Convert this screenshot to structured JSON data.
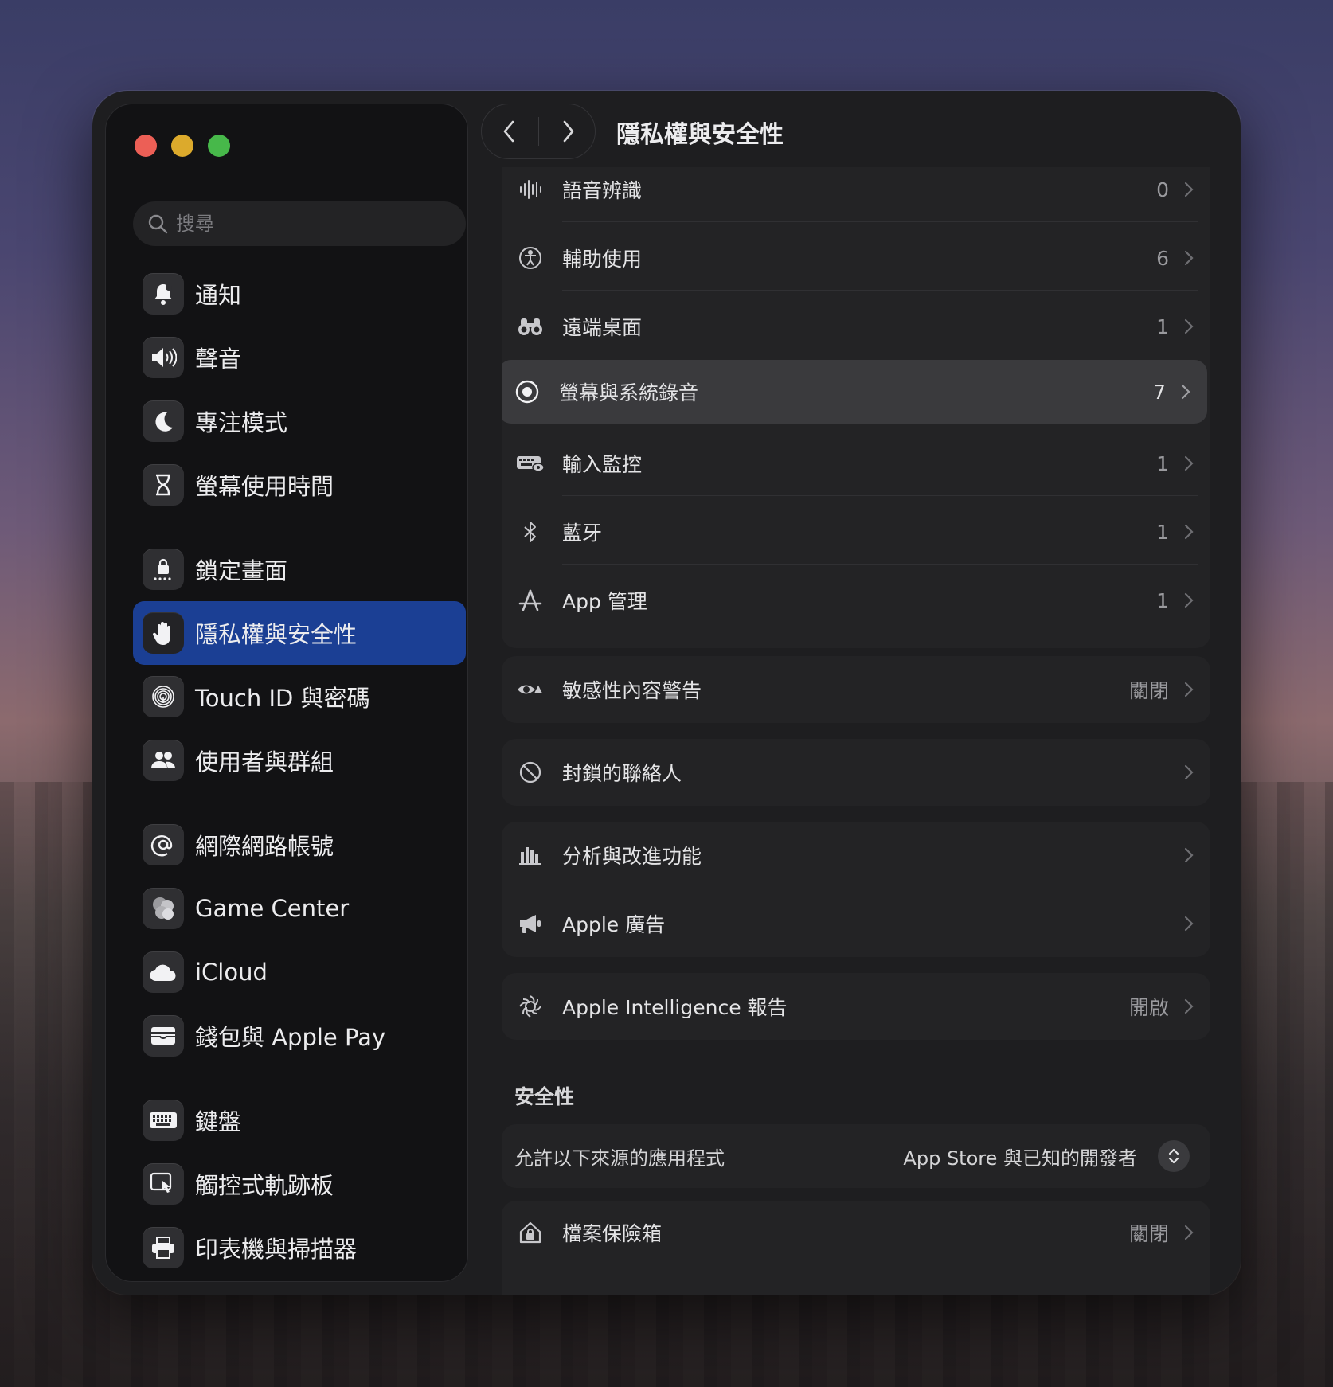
{
  "window": {
    "title": "隱私權與安全性"
  },
  "search": {
    "placeholder": "搜尋"
  },
  "sidebar": {
    "items": [
      {
        "label": "通知",
        "icon": "bell-icon"
      },
      {
        "label": "聲音",
        "icon": "speaker-icon"
      },
      {
        "label": "專注模式",
        "icon": "moon-icon"
      },
      {
        "label": "螢幕使用時間",
        "icon": "hourglass-icon"
      },
      {
        "label": "鎖定畫面",
        "icon": "lock-icon"
      },
      {
        "label": "隱私權與安全性",
        "icon": "hand-icon"
      },
      {
        "label": "Touch ID 與密碼",
        "icon": "fingerprint-icon"
      },
      {
        "label": "使用者與群組",
        "icon": "users-icon"
      },
      {
        "label": "網際網路帳號",
        "icon": "at-icon"
      },
      {
        "label": "Game Center",
        "icon": "game-center-icon"
      },
      {
        "label": "iCloud",
        "icon": "cloud-icon"
      },
      {
        "label": "錢包與 Apple Pay",
        "icon": "wallet-icon"
      },
      {
        "label": "鍵盤",
        "icon": "keyboard-icon"
      },
      {
        "label": "觸控式軌跡板",
        "icon": "trackpad-icon"
      },
      {
        "label": "印表機與掃描器",
        "icon": "printer-icon"
      }
    ],
    "active": "隱私權與安全性"
  },
  "privacy": {
    "rows": [
      {
        "label": "語音辨識",
        "value": "0",
        "icon": "waveform-icon"
      },
      {
        "label": "輔助使用",
        "value": "6",
        "icon": "accessibility-icon"
      },
      {
        "label": "遠端桌面",
        "value": "1",
        "icon": "binoculars-icon"
      },
      {
        "label": "螢幕與系統錄音",
        "value": "7",
        "icon": "record-icon"
      },
      {
        "label": "輸入監控",
        "value": "1",
        "icon": "keyboard-eye-icon"
      },
      {
        "label": "藍牙",
        "value": "1",
        "icon": "bluetooth-icon"
      },
      {
        "label": "App 管理",
        "value": "1",
        "icon": "app-store-icon"
      }
    ],
    "selected": "螢幕與系統錄音",
    "sensitive": {
      "label": "敏感性內容警告",
      "value": "關閉",
      "icon": "eye-warning-icon"
    },
    "blocked": {
      "label": "封鎖的聯絡人",
      "icon": "blocked-icon"
    },
    "analytics": [
      {
        "label": "分析與改進功能",
        "icon": "chart-icon"
      },
      {
        "label": "Apple 廣告",
        "icon": "megaphone-icon"
      }
    ],
    "intelligence": {
      "label": "Apple Intelligence 報告",
      "value": "開啟",
      "icon": "apple-intelligence-icon"
    }
  },
  "security": {
    "title": "安全性",
    "allow_label": "允許以下來源的應用程式",
    "allow_value": "App Store 與已知的開發者",
    "filevault": {
      "label": "檔案保險箱",
      "value": "關閉",
      "icon": "house-lock-icon"
    }
  }
}
